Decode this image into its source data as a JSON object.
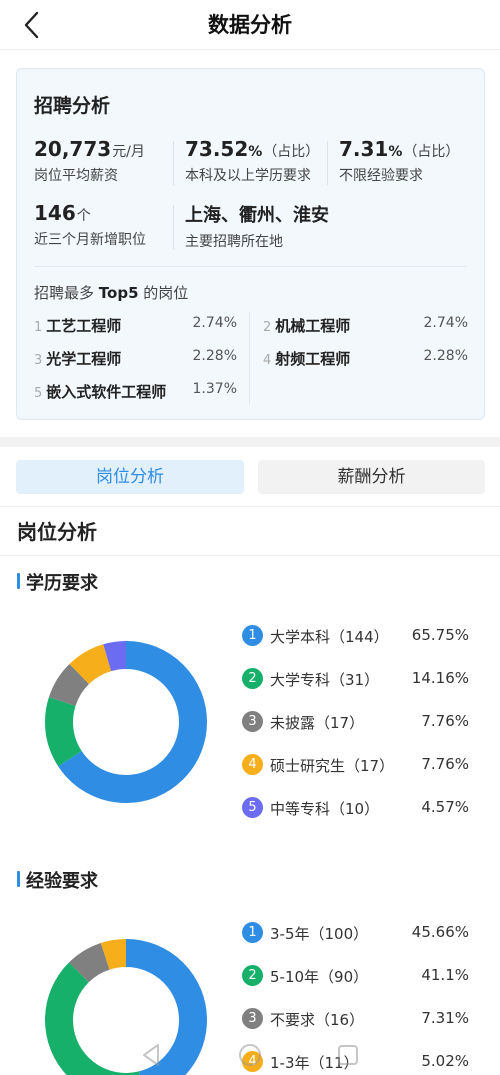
{
  "header": {
    "title": "数据分析"
  },
  "recruit": {
    "title": "招聘分析",
    "salary": {
      "value": "20,773",
      "unit": "元/月",
      "desc": "岗位平均薪资"
    },
    "bachelor": {
      "value": "73.52",
      "unit": "%",
      "note": "（占比）",
      "desc": "本科及以上学历要求"
    },
    "noexp": {
      "value": "7.31",
      "unit": "%",
      "note": "（占比）",
      "desc": "不限经验要求"
    },
    "newjobs": {
      "value": "146",
      "unit": "个",
      "desc": "近三个月新增职位"
    },
    "cities": {
      "value": "上海、衢州、淮安",
      "desc": "主要招聘所在地"
    },
    "top5": {
      "title_prefix": "招聘最多 ",
      "title_bold": "Top5",
      "title_suffix": " 的岗位",
      "items": [
        {
          "rank": "1",
          "name": "工艺工程师",
          "pct": "2.74%"
        },
        {
          "rank": "2",
          "name": "机械工程师",
          "pct": "2.74%"
        },
        {
          "rank": "3",
          "name": "光学工程师",
          "pct": "2.28%"
        },
        {
          "rank": "4",
          "name": "射频工程师",
          "pct": "2.28%"
        },
        {
          "rank": "5",
          "name": "嵌入式软件工程师",
          "pct": "1.37%"
        }
      ]
    }
  },
  "tabs": {
    "active": "岗位分析",
    "inactive": "薪酬分析"
  },
  "section_title": "岗位分析",
  "education": {
    "title": "学历要求",
    "items": [
      {
        "rank": "1",
        "label": "大学本科（144）",
        "pct": "65.75%",
        "value": 65.75,
        "color": "#2f8de4"
      },
      {
        "rank": "2",
        "label": "大学专科（31）",
        "pct": "14.16%",
        "value": 14.16,
        "color": "#16b06a"
      },
      {
        "rank": "3",
        "label": "未披露（17）",
        "pct": "7.76%",
        "value": 7.76,
        "color": "#808080"
      },
      {
        "rank": "4",
        "label": "硕士研究生（17）",
        "pct": "7.76%",
        "value": 7.76,
        "color": "#f7ae1b"
      },
      {
        "rank": "5",
        "label": "中等专科（10）",
        "pct": "4.57%",
        "value": 4.57,
        "color": "#6b6cf2"
      }
    ]
  },
  "experience": {
    "title": "经验要求",
    "items": [
      {
        "rank": "1",
        "label": "3-5年（100）",
        "pct": "45.66%",
        "value": 45.66,
        "color": "#2f8de4"
      },
      {
        "rank": "2",
        "label": "5-10年（90）",
        "pct": "41.1%",
        "value": 41.1,
        "color": "#16b06a"
      },
      {
        "rank": "3",
        "label": "不要求（16）",
        "pct": "7.31%",
        "value": 7.31,
        "color": "#808080"
      },
      {
        "rank": "4",
        "label": "1-3年（11）",
        "pct": "5.02%",
        "value": 5.02,
        "color": "#f7ae1b"
      }
    ]
  }
}
